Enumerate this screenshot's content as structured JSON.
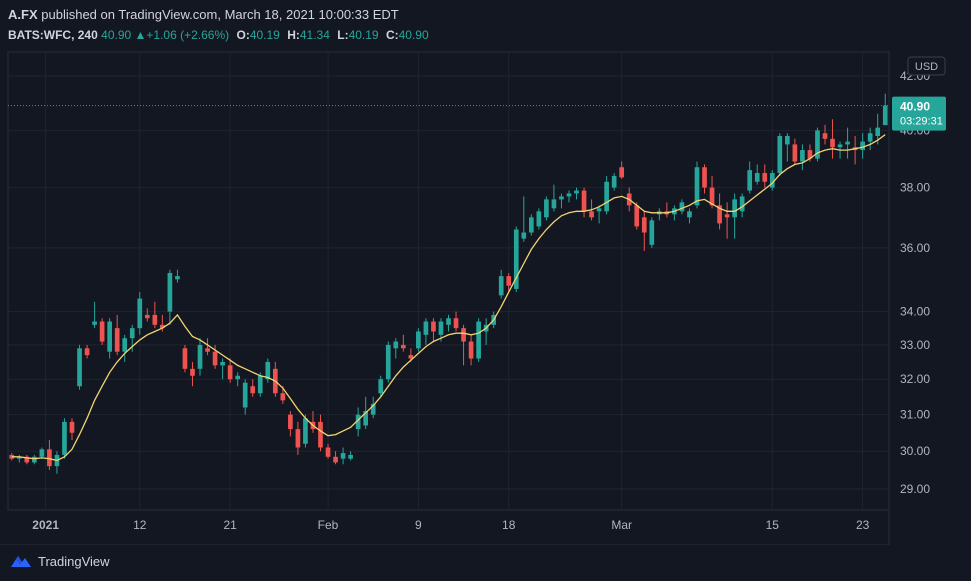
{
  "header": {
    "publisher": "A.FX",
    "published_text": "published on TradingView.com, March 18, 2021 10:00:33 EDT",
    "symbol": "BATS:WFC, 240",
    "last": "40.90",
    "change": "+1.06 (+2.66%)",
    "o_label": "O:",
    "o": "40.19",
    "h_label": "H:",
    "h": "41.34",
    "l_label": "L:",
    "l": "40.19",
    "c_label": "C:",
    "c": "40.90"
  },
  "footer": {
    "brand": "TradingView"
  },
  "colors": {
    "background": "#131722",
    "up": "#26a69a",
    "down": "#ef5350",
    "ma": "#f2d46f",
    "text": "#d1d4dc",
    "grid": "#1f2430"
  },
  "chart_data": {
    "type": "candlestick",
    "currency": "USD",
    "scale": "log",
    "y_ticks": [
      29.0,
      30.0,
      31.0,
      32.0,
      33.0,
      34.0,
      36.0,
      38.0,
      40.0,
      42.0
    ],
    "y_tick_labels": [
      "29.00",
      "30.00",
      "31.00",
      "32.00",
      "33.00",
      "34.00",
      "36.00",
      "38.00",
      "40.00",
      "42.00"
    ],
    "ylim": [
      28.5,
      43.0
    ],
    "x_ticks": [
      {
        "label": "2021",
        "index": 4.5
      },
      {
        "label": "12",
        "index": 17
      },
      {
        "label": "21",
        "index": 29
      },
      {
        "label": "Feb",
        "index": 42
      },
      {
        "label": "9",
        "index": 54
      },
      {
        "label": "18",
        "index": 66
      },
      {
        "label": "Mar",
        "index": 81
      },
      {
        "label": "15",
        "index": 101
      },
      {
        "label": "23",
        "index": 113
      }
    ],
    "x_count": 117,
    "last_price_label": "40.90",
    "countdown_label": "03:29:31",
    "ohlc": [
      [
        29.9,
        29.95,
        29.75,
        29.8
      ],
      [
        29.8,
        29.9,
        29.7,
        29.85
      ],
      [
        29.85,
        29.9,
        29.65,
        29.7
      ],
      [
        29.7,
        29.9,
        29.65,
        29.85
      ],
      [
        29.85,
        30.1,
        29.8,
        30.05
      ],
      [
        30.05,
        30.3,
        29.5,
        29.6
      ],
      [
        29.6,
        30.0,
        29.4,
        29.9
      ],
      [
        29.9,
        30.9,
        29.8,
        30.8
      ],
      [
        30.8,
        30.9,
        30.3,
        30.5
      ],
      [
        31.8,
        33.0,
        31.7,
        32.9
      ],
      [
        32.9,
        33.0,
        32.6,
        32.7
      ],
      [
        33.6,
        34.3,
        33.5,
        33.7
      ],
      [
        33.7,
        33.8,
        33.0,
        33.1
      ],
      [
        32.8,
        33.8,
        32.6,
        33.7
      ],
      [
        33.5,
        33.9,
        32.7,
        32.8
      ],
      [
        32.8,
        33.3,
        32.5,
        33.2
      ],
      [
        33.2,
        33.6,
        32.8,
        33.5
      ],
      [
        33.5,
        34.6,
        33.3,
        34.4
      ],
      [
        33.9,
        34.1,
        33.7,
        33.8
      ],
      [
        33.9,
        34.3,
        33.5,
        33.6
      ],
      [
        33.6,
        33.9,
        33.4,
        33.5
      ],
      [
        34.0,
        35.3,
        33.6,
        35.2
      ],
      [
        35.0,
        35.3,
        34.9,
        35.1
      ],
      [
        32.9,
        33.0,
        32.2,
        32.3
      ],
      [
        32.3,
        32.5,
        31.8,
        32.1
      ],
      [
        32.3,
        33.2,
        32.1,
        33.0
      ],
      [
        32.9,
        33.2,
        32.7,
        32.8
      ],
      [
        32.8,
        33.0,
        32.3,
        32.4
      ],
      [
        32.4,
        32.6,
        32.0,
        32.5
      ],
      [
        32.4,
        32.6,
        31.9,
        32.0
      ],
      [
        32.0,
        32.2,
        31.8,
        32.1
      ],
      [
        31.2,
        32.0,
        31.0,
        31.9
      ],
      [
        31.8,
        32.0,
        31.5,
        31.6
      ],
      [
        31.6,
        32.2,
        31.5,
        32.1
      ],
      [
        32.0,
        32.6,
        31.9,
        32.5
      ],
      [
        32.3,
        32.5,
        31.5,
        31.6
      ],
      [
        31.6,
        31.8,
        31.3,
        31.4
      ],
      [
        31.0,
        31.1,
        30.4,
        30.6
      ],
      [
        30.6,
        30.8,
        29.9,
        30.1
      ],
      [
        30.2,
        31.0,
        30.1,
        30.9
      ],
      [
        30.8,
        31.1,
        30.5,
        30.6
      ],
      [
        30.8,
        31.0,
        30.0,
        30.1
      ],
      [
        30.1,
        30.2,
        29.8,
        29.85
      ],
      [
        29.85,
        30.0,
        29.65,
        29.7
      ],
      [
        29.8,
        30.1,
        29.65,
        29.95
      ],
      [
        29.8,
        30.0,
        29.75,
        29.9
      ],
      [
        30.6,
        31.2,
        30.4,
        31.0
      ],
      [
        30.7,
        31.5,
        30.6,
        31.1
      ],
      [
        31.0,
        31.5,
        30.9,
        31.3
      ],
      [
        31.6,
        32.1,
        31.5,
        32.0
      ],
      [
        32.0,
        33.1,
        31.9,
        33.0
      ],
      [
        32.9,
        33.2,
        32.6,
        33.1
      ],
      [
        33.0,
        33.3,
        32.8,
        32.9
      ],
      [
        32.7,
        32.9,
        32.5,
        32.6
      ],
      [
        32.9,
        33.5,
        32.8,
        33.4
      ],
      [
        33.3,
        33.8,
        33.0,
        33.7
      ],
      [
        33.7,
        33.8,
        33.1,
        33.4
      ],
      [
        33.3,
        33.8,
        33.1,
        33.7
      ],
      [
        33.6,
        33.9,
        33.4,
        33.8
      ],
      [
        33.8,
        34.0,
        33.4,
        33.5
      ],
      [
        33.5,
        33.6,
        32.4,
        33.1
      ],
      [
        33.1,
        33.3,
        32.4,
        32.6
      ],
      [
        32.6,
        33.8,
        32.5,
        33.7
      ],
      [
        33.4,
        33.8,
        33.0,
        33.6
      ],
      [
        33.6,
        34.0,
        33.5,
        33.9
      ],
      [
        34.5,
        35.3,
        34.4,
        35.1
      ],
      [
        35.1,
        35.2,
        34.6,
        34.8
      ],
      [
        34.7,
        36.7,
        34.6,
        36.6
      ],
      [
        36.3,
        37.7,
        36.2,
        36.5
      ],
      [
        36.5,
        37.1,
        36.4,
        37.0
      ],
      [
        36.7,
        37.3,
        36.6,
        37.2
      ],
      [
        37.0,
        37.7,
        36.9,
        37.6
      ],
      [
        37.3,
        38.1,
        37.2,
        37.6
      ],
      [
        37.6,
        37.8,
        37.3,
        37.7
      ],
      [
        37.7,
        37.9,
        37.5,
        37.8
      ],
      [
        37.8,
        38.0,
        37.6,
        37.9
      ],
      [
        37.9,
        38.0,
        37.0,
        37.2
      ],
      [
        37.2,
        37.6,
        36.9,
        37.0
      ],
      [
        37.2,
        37.4,
        36.8,
        37.3
      ],
      [
        37.2,
        38.4,
        37.1,
        38.2
      ],
      [
        38.0,
        38.5,
        37.9,
        38.4
      ],
      [
        38.7,
        38.9,
        38.3,
        38.35
      ],
      [
        37.8,
        38.0,
        37.2,
        37.4
      ],
      [
        37.4,
        37.5,
        36.6,
        36.7
      ],
      [
        37.0,
        37.2,
        35.9,
        36.5
      ],
      [
        36.1,
        37.0,
        36.0,
        36.9
      ],
      [
        37.1,
        37.3,
        36.9,
        37.2
      ],
      [
        37.2,
        37.5,
        37.0,
        37.1
      ],
      [
        37.1,
        37.4,
        36.9,
        37.3
      ],
      [
        37.2,
        37.6,
        37.1,
        37.5
      ],
      [
        37.0,
        37.3,
        36.8,
        37.2
      ],
      [
        37.4,
        38.9,
        37.3,
        38.7
      ],
      [
        38.7,
        38.8,
        37.8,
        38.0
      ],
      [
        38.0,
        38.4,
        37.3,
        37.4
      ],
      [
        37.4,
        37.8,
        36.6,
        36.8
      ],
      [
        37.1,
        37.5,
        36.3,
        37.0
      ],
      [
        37.0,
        37.8,
        36.3,
        37.6
      ],
      [
        37.2,
        37.8,
        37.0,
        37.7
      ],
      [
        37.9,
        38.9,
        37.8,
        38.6
      ],
      [
        38.2,
        38.8,
        38.1,
        38.5
      ],
      [
        38.5,
        38.8,
        38.0,
        38.2
      ],
      [
        38.0,
        38.6,
        37.9,
        38.5
      ],
      [
        38.5,
        39.9,
        38.4,
        39.8
      ],
      [
        39.5,
        39.9,
        38.9,
        39.8
      ],
      [
        39.5,
        39.7,
        38.8,
        38.9
      ],
      [
        38.9,
        39.5,
        38.6,
        39.3
      ],
      [
        39.3,
        39.5,
        38.9,
        39.0
      ],
      [
        39.0,
        40.1,
        38.9,
        40.0
      ],
      [
        39.9,
        40.2,
        39.5,
        39.7
      ],
      [
        39.7,
        40.4,
        39.0,
        39.4
      ],
      [
        39.4,
        39.6,
        39.0,
        39.5
      ],
      [
        39.5,
        40.1,
        39.0,
        39.6
      ],
      [
        39.4,
        39.8,
        38.8,
        39.3
      ],
      [
        39.3,
        39.9,
        39.0,
        39.6
      ],
      [
        39.6,
        40.1,
        39.3,
        39.9
      ],
      [
        39.8,
        40.6,
        39.5,
        40.1
      ],
      [
        40.19,
        41.34,
        40.19,
        40.9
      ]
    ],
    "ma": [
      29.85,
      29.85,
      29.82,
      29.8,
      29.82,
      29.8,
      29.75,
      29.85,
      30.05,
      30.45,
      30.9,
      31.4,
      31.8,
      32.2,
      32.5,
      32.75,
      32.95,
      33.15,
      33.3,
      33.4,
      33.5,
      33.65,
      33.9,
      33.55,
      33.25,
      33.15,
      33.0,
      32.85,
      32.7,
      32.55,
      32.4,
      32.3,
      32.2,
      32.1,
      32.05,
      31.95,
      31.75,
      31.45,
      31.15,
      30.9,
      30.7,
      30.55,
      30.42,
      30.45,
      30.55,
      30.65,
      30.85,
      31.05,
      31.25,
      31.5,
      31.8,
      32.1,
      32.35,
      32.55,
      32.75,
      32.95,
      33.1,
      33.2,
      33.3,
      33.35,
      33.35,
      33.3,
      33.35,
      33.5,
      33.75,
      34.15,
      34.6,
      35.05,
      35.5,
      35.95,
      36.3,
      36.6,
      36.85,
      37.05,
      37.15,
      37.2,
      37.2,
      37.25,
      37.35,
      37.5,
      37.65,
      37.7,
      37.6,
      37.4,
      37.2,
      37.15,
      37.15,
      37.15,
      37.2,
      37.3,
      37.4,
      37.55,
      37.6,
      37.45,
      37.3,
      37.2,
      37.2,
      37.35,
      37.55,
      37.75,
      37.95,
      38.15,
      38.45,
      38.65,
      38.8,
      38.85,
      39.0,
      39.2,
      39.3,
      39.35,
      39.3,
      39.3,
      39.35,
      39.4,
      39.5,
      39.65,
      39.85
    ]
  }
}
